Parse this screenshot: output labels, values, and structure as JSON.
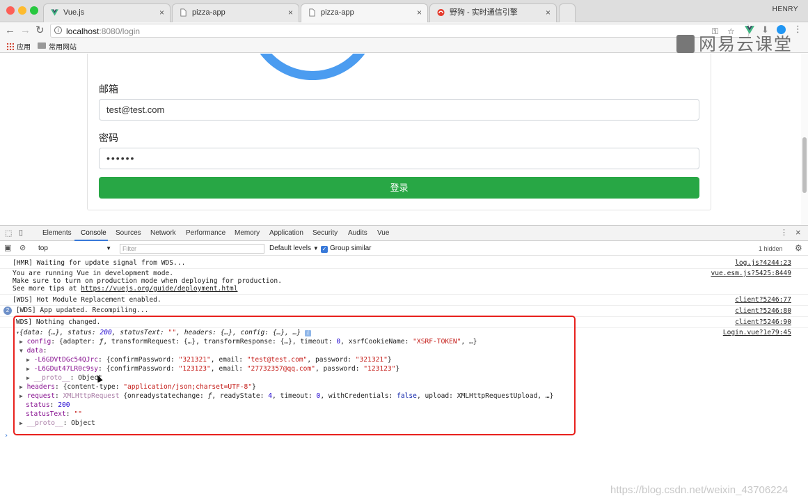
{
  "browser": {
    "tabs": [
      {
        "title": "Vue.js",
        "active": false
      },
      {
        "title": "pizza-app",
        "active": false
      },
      {
        "title": "pizza-app",
        "active": true
      },
      {
        "title": "野狗 - 实时通信引擎",
        "active": false
      }
    ],
    "tab_close_glyph": "×",
    "profile_name": "HENRY",
    "url_host": "localhost",
    "url_rest": ":8080/login",
    "bookmarks": [
      {
        "label": "应用"
      },
      {
        "label": "常用网站"
      }
    ]
  },
  "watermark_top": "网易云课堂",
  "watermark_bottom": "https://blog.csdn.net/weixin_43706224",
  "form": {
    "email_label": "邮箱",
    "email_value": "test@test.com",
    "password_label": "密码",
    "password_value": "••••••",
    "submit_label": "登录",
    "submit_color": "#28a745",
    "accent_color": "#4b9cf0"
  },
  "devtools": {
    "tabs": [
      "Elements",
      "Console",
      "Sources",
      "Network",
      "Performance",
      "Memory",
      "Application",
      "Security",
      "Audits",
      "Vue"
    ],
    "active_tab": "Console",
    "context": "top",
    "filter_placeholder": "Filter",
    "levels": "Default levels",
    "group_similar": "Group similar",
    "hidden_count": "1 hidden"
  },
  "console": {
    "hmr_line": "[HMR] Waiting for update signal from WDS...",
    "hmr_src": "log.js?4244:23",
    "vue_line1": "You are running Vue in development mode.",
    "vue_line2": "Make sure to turn on production mode when deploying for production.",
    "vue_line3_prefix": "See more tips at ",
    "vue_line3_link": "https://vuejs.org/guide/deployment.html",
    "vue_src": "vue.esm.js?5425:8449",
    "wds1": "[WDS] Hot Module Replacement enabled.",
    "wds1_src": "client?5246:77",
    "wds2_badge": "2",
    "wds2": "[WDS] App updated. Recompiling...",
    "wds2_src": "client?5246:80",
    "wds3": "WDS] Nothing changed.",
    "wds3_src": "client?5246:90",
    "obj_src": "Login.vue?1e79:45",
    "obj_summary": {
      "open": "{",
      "data_key": "data",
      "data_val": "{…}",
      "status_key": "status",
      "status_val": "200",
      "statusText_key": "statusText",
      "statusText_val": "\"\"",
      "headers_key": "headers",
      "headers_val": "{…}",
      "config_key": "config",
      "config_val": "{…}",
      "close": "…}"
    },
    "config_line": {
      "key": "config",
      "p1": "{adapter: ",
      "f1": "ƒ",
      "p2": ", transformRequest: {…}, transformResponse: {…}, timeout: ",
      "timeout": "0",
      "p3": ", xsrfCookieName: ",
      "xsrf": "\"XSRF-TOKEN\"",
      "p4": ", …}"
    },
    "data_key": "data",
    "entries": [
      {
        "key": "-L6GDVtDGc54QJrc",
        "confirm": "\"321321\"",
        "email": "\"test@test.com\"",
        "password": "\"321321\""
      },
      {
        "key": "-L6GDut47LR0c9sy",
        "confirm": "\"123123\"",
        "email": "\"27732357@qq.com\"",
        "password": "\"123123\""
      }
    ],
    "entry_labels": {
      "open": "{confirmPassword: ",
      "email": ", email: ",
      "password": ", password: ",
      "close": "}"
    },
    "proto_key": "__proto__",
    "proto_val": "Object",
    "headers_line": {
      "key": "headers",
      "p1": "{content-type: ",
      "val": "\"application/json;charset=UTF-8\"",
      "close": "}"
    },
    "request_line": {
      "key": "request",
      "type": "XMLHttpRequest",
      "p1": " {onreadystatechange: ",
      "f1": "ƒ",
      "p2": ", readyState: ",
      "ready": "4",
      "p3": ", timeout: ",
      "timeout": "0",
      "p4": ", withCredentials: ",
      "cred": "false",
      "p5": ", upload: XMLHttpRequestUpload, …}"
    },
    "status_key": "status",
    "status_val": "200",
    "statusText_key": "statusText",
    "statusText_val": "\"\"",
    "prompt": "›"
  }
}
